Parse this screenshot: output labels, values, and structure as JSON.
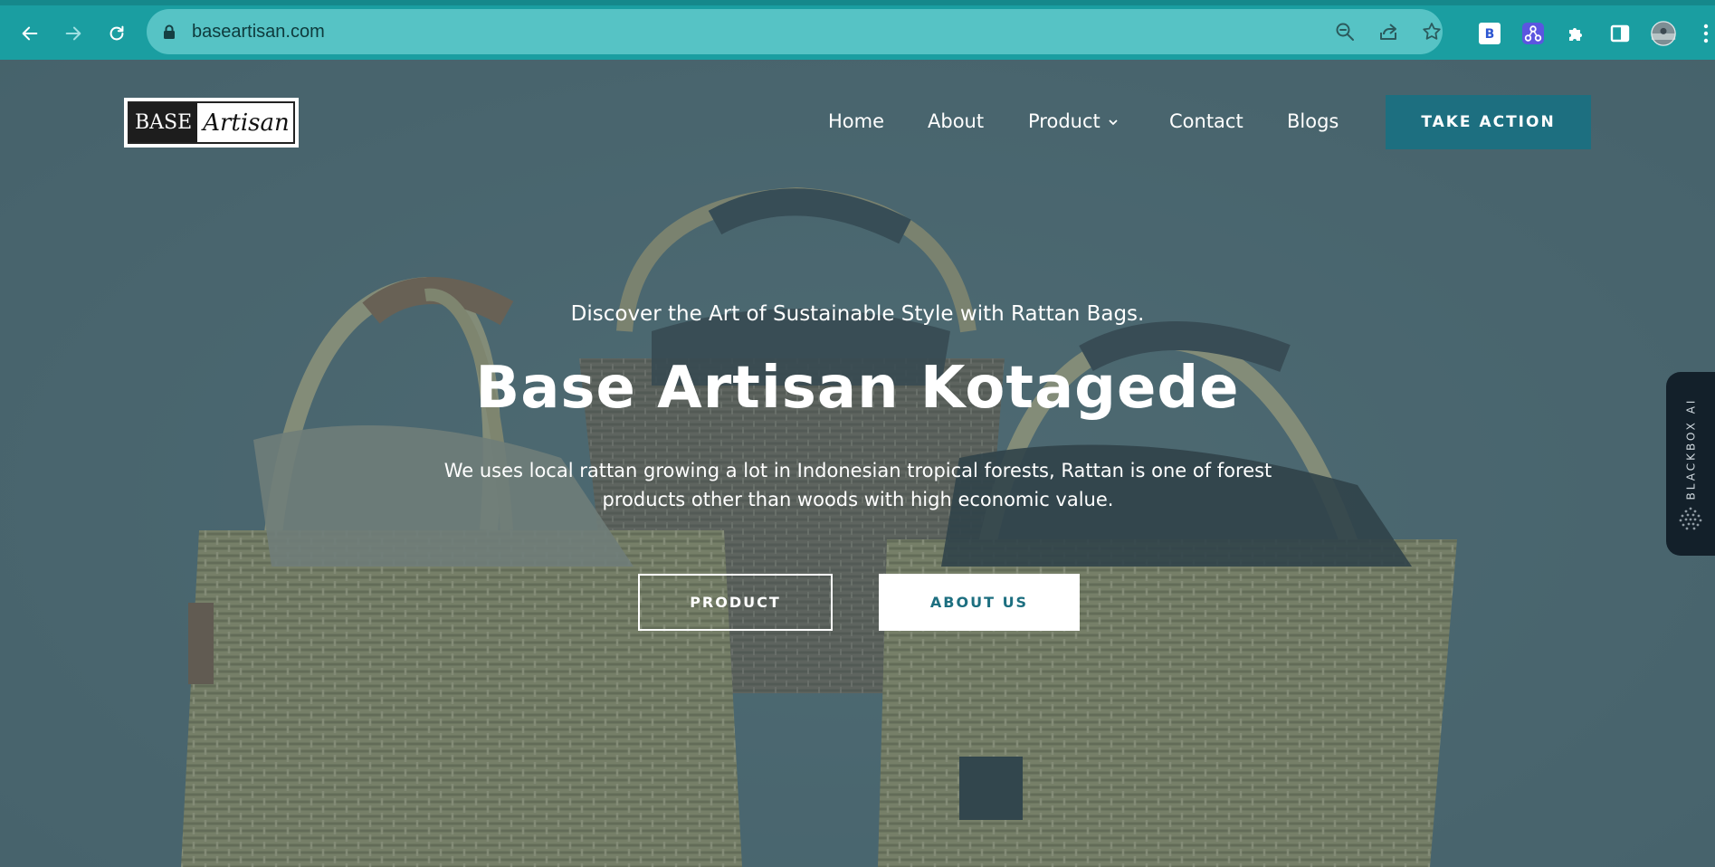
{
  "browser": {
    "url": "baseartisan.com",
    "extensions": [
      "bold-b-icon",
      "share-nodes-icon",
      "puzzle-icon",
      "sidebar-icon",
      "avatar"
    ]
  },
  "site": {
    "logo": {
      "part1": "BASE",
      "part2": "Artisan"
    },
    "nav": {
      "home": "Home",
      "about": "About",
      "product": "Product",
      "contact": "Contact",
      "blogs": "Blogs"
    },
    "cta_label": "TAKE ACTION"
  },
  "hero": {
    "tagline": "Discover the Art of Sustainable Style with Rattan Bags.",
    "title": "Base Artisan Kotagede",
    "description": "We uses local rattan growing a lot in Indonesian tropical forests, Rattan is one of forest products other than woods with high economic value.",
    "button_product": "PRODUCT",
    "button_about": "ABOUT US"
  },
  "side_widget": {
    "label": "BLACKBOX AI"
  },
  "colors": {
    "chrome": "#1a9ea1",
    "omnibox": "#56c3c5",
    "accent": "#1d6f80",
    "overlay": "#4f6a72"
  }
}
